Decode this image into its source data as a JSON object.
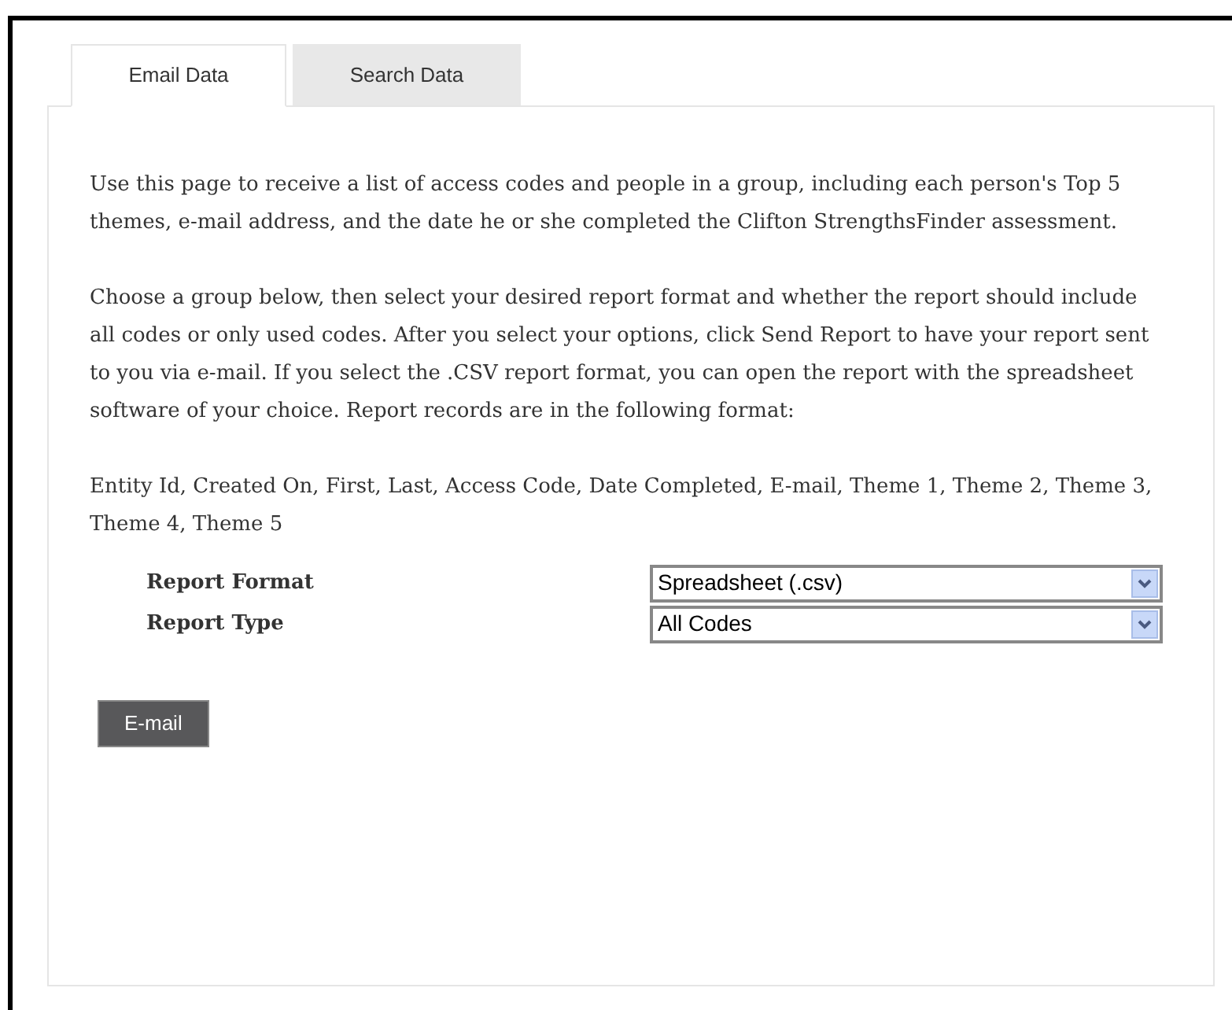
{
  "tabs": [
    {
      "label": "Email Data",
      "selected": true
    },
    {
      "label": "Search Data",
      "selected": false
    }
  ],
  "paragraphs": [
    "Use this page to receive a list of access codes and people in a group, including each person's Top 5 themes, e-mail address, and the date he or she completed the Clifton StrengthsFinder assessment.",
    "Choose a group below, then select your desired report format and whether the report should include all codes or only used codes. After you select your options, click Send Report to have your report sent to you via e-mail. If you select the .CSV report format, you can open the report with the spreadsheet software of your choice. Report records are in the following format:",
    "Entity Id, Created On, First, Last, Access Code, Date Completed, E-mail, Theme 1, Theme 2, Theme 3, Theme 4, Theme 5"
  ],
  "form": [
    {
      "label": "Report Format",
      "value": "Spreadsheet (.csv)"
    },
    {
      "label": "Report Type",
      "value": "All Codes"
    }
  ],
  "button": "E-mail"
}
